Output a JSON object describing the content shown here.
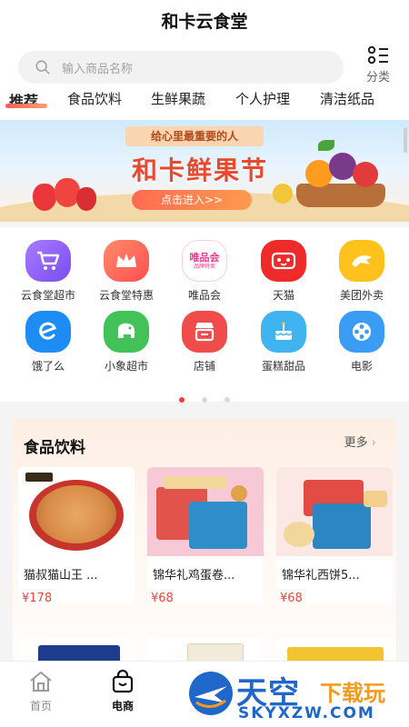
{
  "header": {
    "title": "和卡云食堂",
    "search_placeholder": "输入商品名称",
    "category_label": "分类"
  },
  "tabs": [
    {
      "label": "推荐",
      "active": true
    },
    {
      "label": "食品饮料"
    },
    {
      "label": "生鲜果蔬"
    },
    {
      "label": "个人护理"
    },
    {
      "label": "清洁纸品"
    }
  ],
  "banner": {
    "ribbon": "给心里最重要的人",
    "headline": "和卡鲜果节",
    "button": "点击进入>>"
  },
  "shortcuts": [
    {
      "label": "云食堂超市",
      "icon": "cart-icon",
      "color": "#8b5cf6"
    },
    {
      "label": "云食堂特惠",
      "icon": "crown-icon",
      "color": "#ff6a5a"
    },
    {
      "label": "唯品会",
      "icon": "vip-logo-icon",
      "color": "#f0368e",
      "icon_text": "唯品会",
      "icon_sub": "品牌特卖"
    },
    {
      "label": "天猫",
      "icon": "tmall-icon",
      "color": "#ee2a2a"
    },
    {
      "label": "美团外卖",
      "icon": "kangaroo-icon",
      "color": "#ffc21c"
    },
    {
      "label": "饿了么",
      "icon": "eleme-icon",
      "color": "#1e8cf5"
    },
    {
      "label": "小象超市",
      "icon": "elephant-icon",
      "color": "#43c25a"
    },
    {
      "label": "店铺",
      "icon": "store-icon",
      "color": "#f04c4c"
    },
    {
      "label": "蛋糕甜品",
      "icon": "cake-icon",
      "color": "#3fb4f0"
    },
    {
      "label": "电影",
      "icon": "film-reel-icon",
      "color": "#3b9cf5"
    }
  ],
  "pager": {
    "count": 3,
    "active_index": 0
  },
  "section": {
    "title": "食品饮料",
    "more": "更多",
    "products": [
      {
        "name": "猫叔猫山王 ...",
        "price": "¥178"
      },
      {
        "name": "锦华礼鸡蛋卷...",
        "price": "¥68"
      },
      {
        "name": "锦华礼西饼5...",
        "price": "¥68"
      }
    ]
  },
  "bottom_nav": [
    {
      "label": "首页",
      "icon": "home-icon"
    },
    {
      "label": "电商",
      "icon": "shopping-bag-icon",
      "active": true
    }
  ],
  "watermark": {
    "text_main": "天空",
    "text_sub": "下载玩",
    "text_en": "SKYXZW.COM"
  }
}
